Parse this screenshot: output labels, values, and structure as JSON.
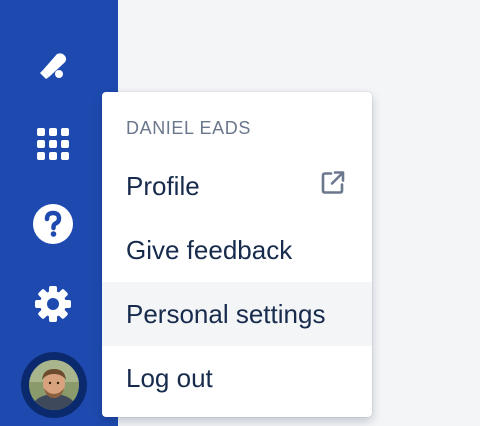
{
  "sidebar": {
    "icons": [
      "notification-icon",
      "app-switcher-icon",
      "help-icon",
      "settings-icon",
      "avatar"
    ],
    "accent_color": "#1E4AB0"
  },
  "profile_menu": {
    "heading": "DANIEL EADS",
    "items": [
      {
        "label": "Profile",
        "icon": "external-link-icon"
      },
      {
        "label": "Give feedback"
      },
      {
        "label": "Personal settings",
        "state": "hovered"
      },
      {
        "label": "Log out"
      }
    ]
  }
}
